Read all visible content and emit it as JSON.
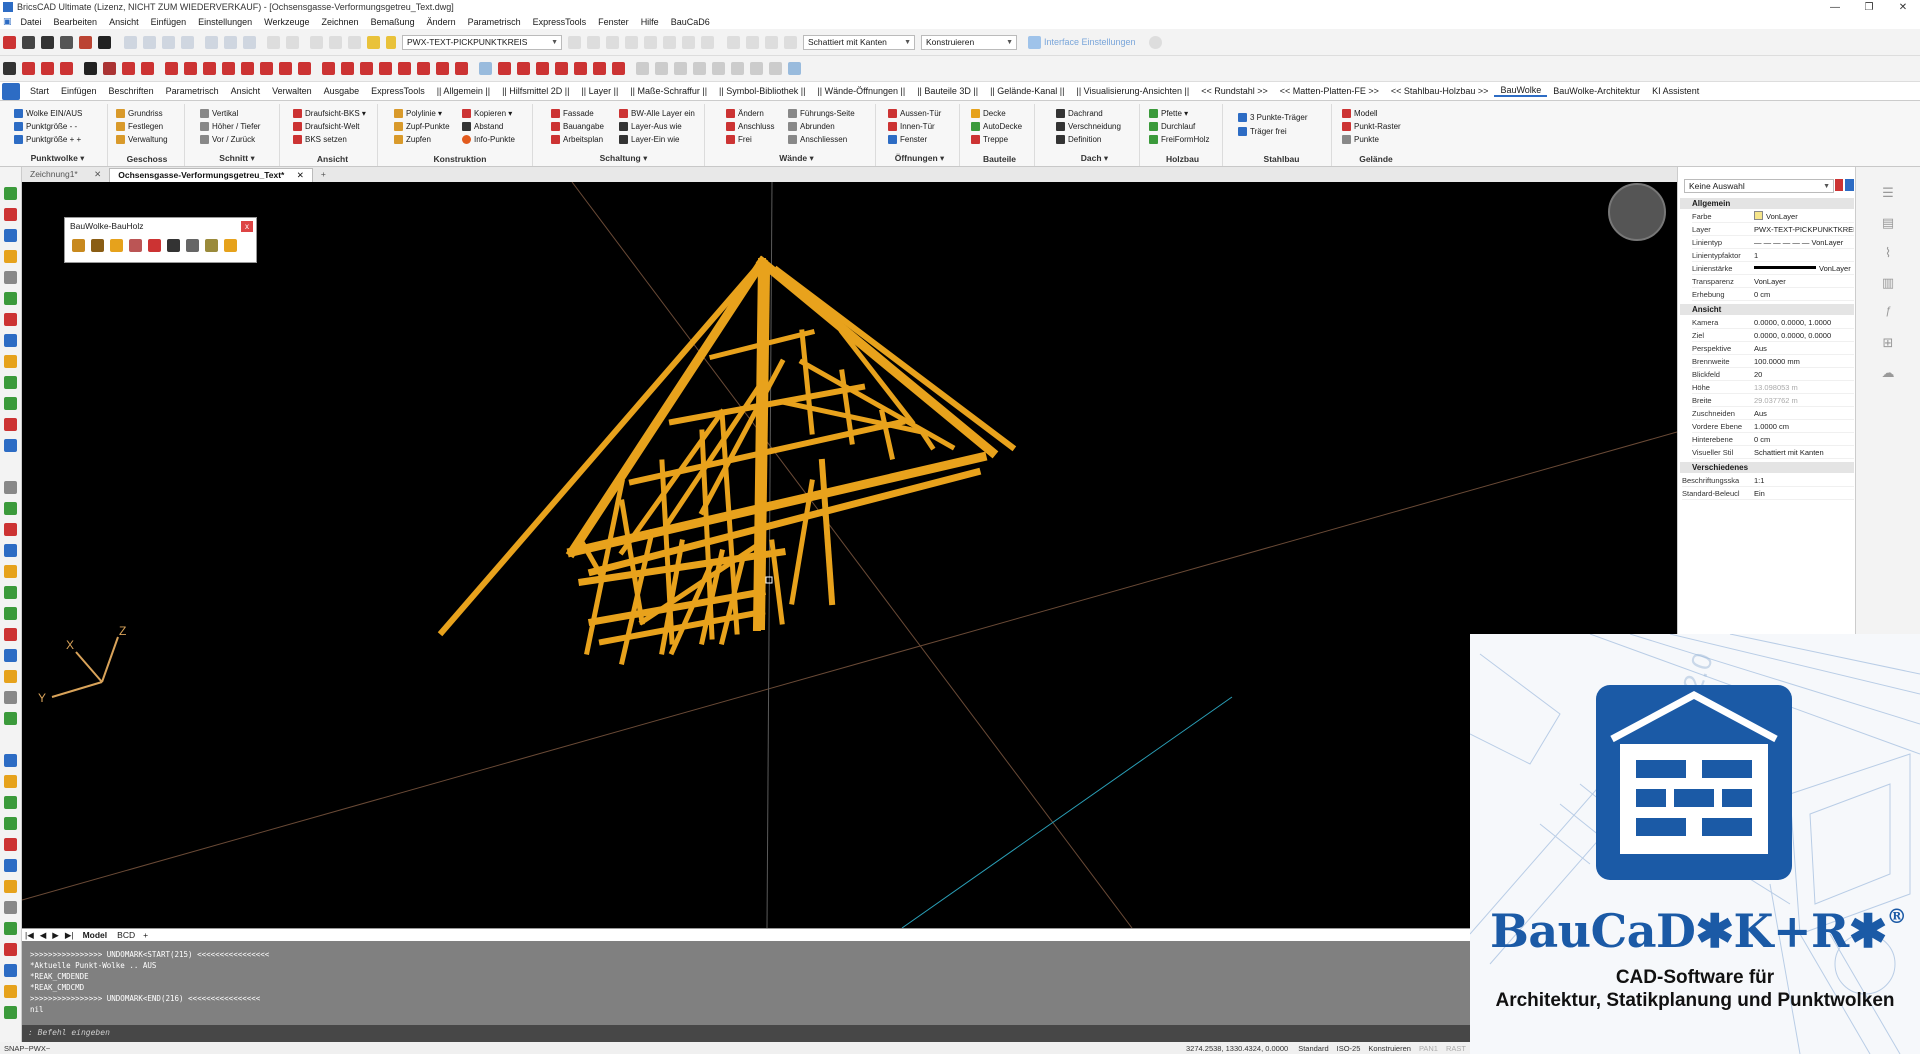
{
  "title_bar": {
    "title": "BricsCAD Ultimate (Lizenz, NICHT ZUM WIEDERVERKAUF) - [Ochsensgasse-Verformungsgetreu_Text.dwg]",
    "min": "—",
    "max": "❐",
    "close": "✕"
  },
  "menu": [
    "Datei",
    "Bearbeiten",
    "Ansicht",
    "Einfügen",
    "Einstellungen",
    "Werkzeuge",
    "Zeichnen",
    "Bemaßung",
    "Ändern",
    "Parametrisch",
    "ExpressTools",
    "Fenster",
    "Hilfe",
    "BauCaD6"
  ],
  "toolbar": {
    "layer": "PWX-TEXT-PICKPUNKTKREIS",
    "visual_style": "Schattiert mit Kanten",
    "workspace": "Konstruieren",
    "interface_link": "Interface Einstellungen"
  },
  "ribbon_tabs": [
    "Start",
    "Einfügen",
    "Beschriften",
    "Parametrisch",
    "Ansicht",
    "Verwalten",
    "Ausgabe",
    "ExpressTools",
    "|| Allgemein ||",
    "|| Hilfsmittel 2D ||",
    "|| Layer ||",
    "|| Maße-Schraffur ||",
    "|| Symbol-Bibliothek ||",
    "|| Wände-Öffnungen ||",
    "|| Bauteile 3D ||",
    "|| Gelände-Kanal ||",
    "|| Visualisierung-Ansichten ||",
    "<< Rundstahl >>",
    "<< Matten-Platten-FE >>",
    "<< Stahlbau-Holzbau >>",
    "BauWolke",
    "BauWolke-Architektur",
    "KI Assistent"
  ],
  "ribbon_panels": [
    {
      "title": "Punktwolke ▾",
      "items": [
        "Wolke EIN/AUS",
        "Punktgröße - -",
        "Punktgröße + +"
      ]
    },
    {
      "title": "Geschoss",
      "items": [
        "Grundriss",
        "Festlegen",
        "Verwaltung"
      ]
    },
    {
      "title": "Schnitt ▾",
      "items": [
        "Vertikal",
        "Höher / Tiefer",
        "Vor / Zurück"
      ]
    },
    {
      "title": "Ansicht",
      "items": [
        "Draufsicht-BKS ▾",
        "Draufsicht-Welt",
        "BKS setzen"
      ]
    },
    {
      "title": "Konstruktion",
      "items": [
        "Polylinie ▾",
        "Zupf-Punkte",
        "Zupfen",
        "Kopieren ▾",
        "Abstand",
        "Info-Punkte"
      ]
    },
    {
      "title": "Schaltung ▾",
      "items": [
        "Fassade",
        "Bauangabe",
        "Arbeitsplan",
        "BW-Alle Layer ein",
        "Layer-Aus wie",
        "Layer-Ein wie"
      ]
    },
    {
      "title": "Wände ▾",
      "items": [
        "Ändern",
        "Anschluss",
        "Frei",
        "Führungs-Seite",
        "Abrunden",
        "Anschliessen"
      ]
    },
    {
      "title": "Öffnungen ▾",
      "items": [
        "Aussen-Tür",
        "Innen-Tür",
        "Fenster"
      ]
    },
    {
      "title": "Bauteile",
      "items": [
        "Decke",
        "AutoDecke",
        "Treppe"
      ]
    },
    {
      "title": "Dach ▾",
      "items": [
        "Dachrand",
        "Verschneidung",
        "Definition"
      ]
    },
    {
      "title": "Holzbau",
      "items": [
        "Pfette ▾",
        "Durchlauf",
        "FreiFormHolz"
      ]
    },
    {
      "title": "Stahlbau",
      "items": [
        "3 Punkte-Träger",
        "Träger frei"
      ]
    },
    {
      "title": "Gelände",
      "items": [
        "Modell",
        "Punkt-Raster",
        "Punkte"
      ]
    }
  ],
  "doc_tabs": [
    {
      "label": "Zeichnung1*",
      "close": "✕"
    },
    {
      "label": "Ochsensgasse-Verformungsgetreu_Text*",
      "close": "✕"
    }
  ],
  "doc_tab_add": "+",
  "bauholz": {
    "title": "BauWolke-BauHolz",
    "close": "x"
  },
  "viewport": {
    "axis_x": "X",
    "axis_y": "Y",
    "axis_z": "Z"
  },
  "model_bar": {
    "nav": [
      "|◀",
      "◀",
      "▶",
      "▶|"
    ],
    "model": "Model",
    "layout": "BCD",
    "add": "+"
  },
  "command_lines": [
    ">>>>>>>>>>>>>>>> UNDOMARK<START(215) <<<<<<<<<<<<<<<<",
    "*Aktuelle Punkt-Wolke .. AUS",
    "*REAK_CMDENDE",
    "*REAK_CMDCMD",
    ">>>>>>>>>>>>>>>> UNDOMARK<END(216) <<<<<<<<<<<<<<<<",
    "nil"
  ],
  "command_prompt": ": Befehl eingeben",
  "status": {
    "left": "SNAP~PWX~",
    "coords": "3274.2538, 1330.4324, 0.0000",
    "items": [
      "Standard",
      "ISO-25",
      "Konstruieren",
      "PAN1",
      "RAST"
    ]
  },
  "properties": {
    "selection": "Keine Auswahl",
    "groups": [
      {
        "name": "Allgemein",
        "rows": [
          {
            "k": "Farbe",
            "v": "VonLayer"
          },
          {
            "k": "Layer",
            "v": "PWX-TEXT-PICKPUNKTKREIS"
          },
          {
            "k": "Linientyp",
            "v": "— — — — — — VonLayer"
          },
          {
            "k": "Linientypfaktor",
            "v": "1"
          },
          {
            "k": "Linienstärke",
            "v": "VonLayer"
          },
          {
            "k": "Transparenz",
            "v": "VonLayer"
          },
          {
            "k": "Erhebung",
            "v": "0 cm"
          }
        ]
      },
      {
        "name": "Ansicht",
        "rows": [
          {
            "k": "Kamera",
            "v": "0.0000, 0.0000, 1.0000"
          },
          {
            "k": "Ziel",
            "v": "0.0000, 0.0000, 0.0000"
          },
          {
            "k": "Perspektive",
            "v": "Aus"
          },
          {
            "k": "Brennweite",
            "v": "100.0000 mm"
          },
          {
            "k": "Blickfeld",
            "v": "20"
          },
          {
            "k": "Höhe",
            "v": "13.098053 m"
          },
          {
            "k": "Breite",
            "v": "29.037762 m"
          },
          {
            "k": "Zuschneiden",
            "v": "Aus"
          },
          {
            "k": "Vordere Ebene",
            "v": "1.0000 cm"
          },
          {
            "k": "Hinterebene",
            "v": "0 cm"
          },
          {
            "k": "Visueller Stil",
            "v": "Schattiert mit Kanten"
          }
        ]
      },
      {
        "name": "Verschiedenes",
        "rows": [
          {
            "k": "Beschriftungsska",
            "v": "1:1"
          },
          {
            "k": "Standard-Beleucl",
            "v": "Ein"
          }
        ]
      }
    ]
  },
  "ad": {
    "brand": "BauCaD✱K+R✱",
    "reg": "®",
    "tagline1": "CAD-Software für",
    "tagline2": "Architektur, Statikplanung und Punktwolken",
    "brand_color": "#1b5aa6"
  },
  "colors": {
    "timber": "#e8a21c",
    "viewport_bg": "#000000",
    "accent": "#2d6cc4"
  }
}
